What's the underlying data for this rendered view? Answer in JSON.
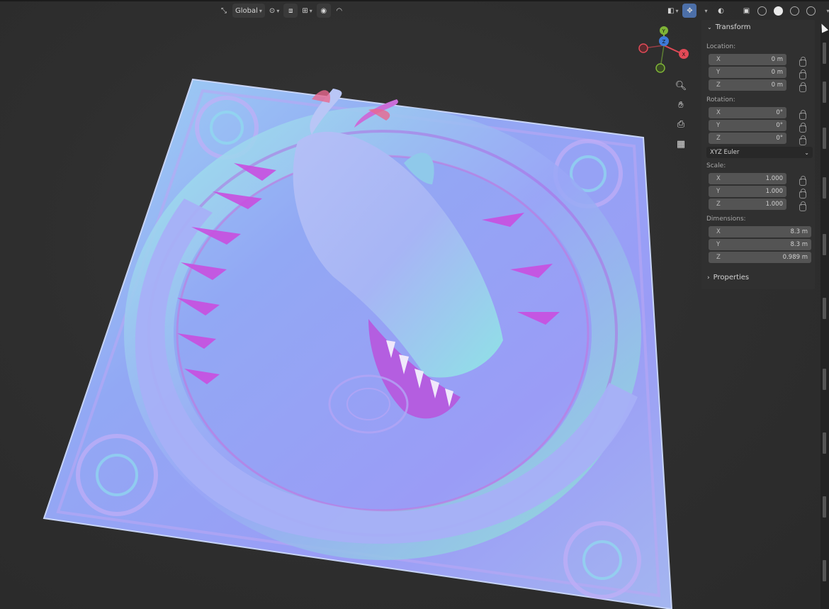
{
  "header": {
    "orientation_label": "Global",
    "icons": [
      "transform-orientation-icon",
      "pivot-icon",
      "snap-icon",
      "proportional-edit-icon",
      "view-object-types-icon",
      "gizmo-icon",
      "overlays-icon",
      "xray-icon",
      "shading-wireframe-icon",
      "shading-solid-icon",
      "shading-material-icon",
      "shading-rendered-icon"
    ]
  },
  "gizmo": {
    "x": "X",
    "y": "Y",
    "z": "Z",
    "colors": {
      "x": "#e14a57",
      "y": "#7fb437",
      "z": "#3d7bd9"
    }
  },
  "panel": {
    "title": "Transform",
    "location": {
      "label": "Location:",
      "rows": [
        {
          "axis": "X",
          "value": "0 m"
        },
        {
          "axis": "Y",
          "value": "0 m"
        },
        {
          "axis": "Z",
          "value": "0 m"
        }
      ]
    },
    "rotation": {
      "label": "Rotation:",
      "rows": [
        {
          "axis": "X",
          "value": "0°"
        },
        {
          "axis": "Y",
          "value": "0°"
        },
        {
          "axis": "Z",
          "value": "0°"
        }
      ]
    },
    "rotation_mode": "XYZ Euler",
    "scale": {
      "label": "Scale:",
      "rows": [
        {
          "axis": "X",
          "value": "1.000"
        },
        {
          "axis": "Y",
          "value": "1.000"
        },
        {
          "axis": "Z",
          "value": "1.000"
        }
      ]
    },
    "dimensions": {
      "label": "Dimensions:",
      "rows": [
        {
          "axis": "X",
          "value": "8.3 m"
        },
        {
          "axis": "Y",
          "value": "8.3 m"
        },
        {
          "axis": "Z",
          "value": "0.989 m"
        }
      ]
    },
    "properties_label": "Properties"
  },
  "colors": {
    "normal_blue": "#8f9cf2",
    "normal_pink": "#e05fc9",
    "normal_cyan": "#8fe3e8",
    "bg": "#2f2f2f"
  }
}
